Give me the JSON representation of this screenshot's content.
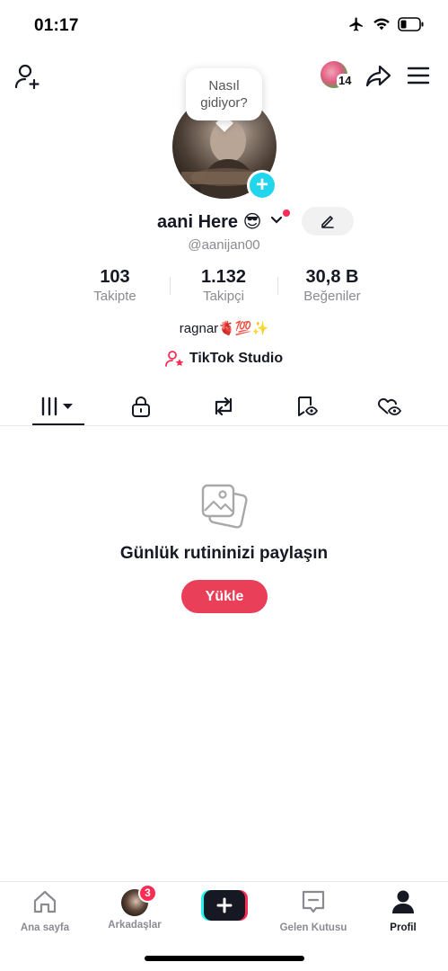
{
  "status_bar": {
    "time": "01:17"
  },
  "top_bar": {
    "notification_count": "14"
  },
  "profile": {
    "tooltip_line1": "Nasıl",
    "tooltip_line2": "gidiyor?",
    "display_name": "aani Here 😎",
    "username": "@aanijan00",
    "bio": "ragnar🫀💯✨",
    "studio_label": "TikTok Studio"
  },
  "stats": [
    {
      "value": "103",
      "label": "Takipte"
    },
    {
      "value": "1.132",
      "label": "Takipçi"
    },
    {
      "value": "30,8 B",
      "label": "Beğeniler"
    }
  ],
  "tabs": [
    {
      "icon": "grid-videos-icon",
      "selected": true
    },
    {
      "icon": "lock-icon"
    },
    {
      "icon": "repost-icon"
    },
    {
      "icon": "bookmark-eye-icon"
    },
    {
      "icon": "liked-eye-icon"
    }
  ],
  "empty_state": {
    "title": "Günlük rutininizi paylaşın",
    "button": "Yükle"
  },
  "bottom_nav": {
    "home": "Ana sayfa",
    "friends": "Arkadaşlar",
    "friends_badge": "3",
    "inbox": "Gelen Kutusu",
    "profile": "Profil"
  },
  "colors": {
    "accent": "#fe2c55",
    "upload_button": "#ea3f59",
    "story_plus": "#20d5ec"
  }
}
